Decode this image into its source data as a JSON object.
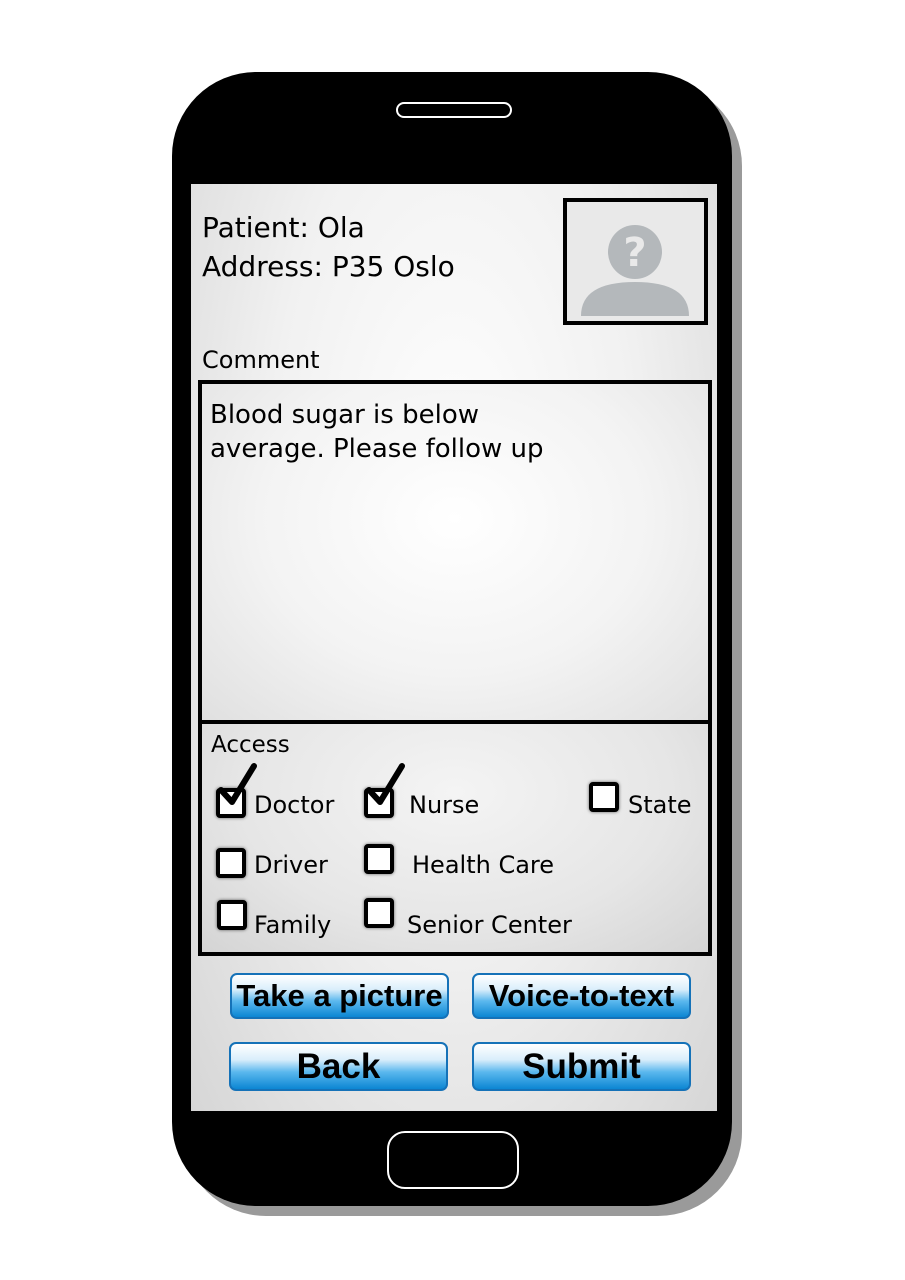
{
  "patient": {
    "name_line": "Patient: Ola",
    "address_line": "Address: P35 Oslo"
  },
  "photo": {
    "icon": "unknown-person-icon"
  },
  "comment": {
    "label": "Comment",
    "text": "Blood sugar is below average. Please follow up"
  },
  "access": {
    "label": "Access",
    "options": [
      {
        "label": "Doctor",
        "checked": true
      },
      {
        "label": "Nurse",
        "checked": true
      },
      {
        "label": "State",
        "checked": false
      },
      {
        "label": "Driver",
        "checked": false
      },
      {
        "label": "Health Care",
        "checked": false
      },
      {
        "label": "Family",
        "checked": false
      },
      {
        "label": "Senior Center",
        "checked": false
      }
    ]
  },
  "buttons": {
    "take_picture": "Take a picture",
    "voice_to_text": "Voice-to-text",
    "back": "Back",
    "submit": "Submit"
  },
  "colors": {
    "button_top": "#ffffff",
    "button_bottom": "#0c86d3",
    "button_border": "#1572b8",
    "placeholder_avatar": "#b4b8bb"
  }
}
